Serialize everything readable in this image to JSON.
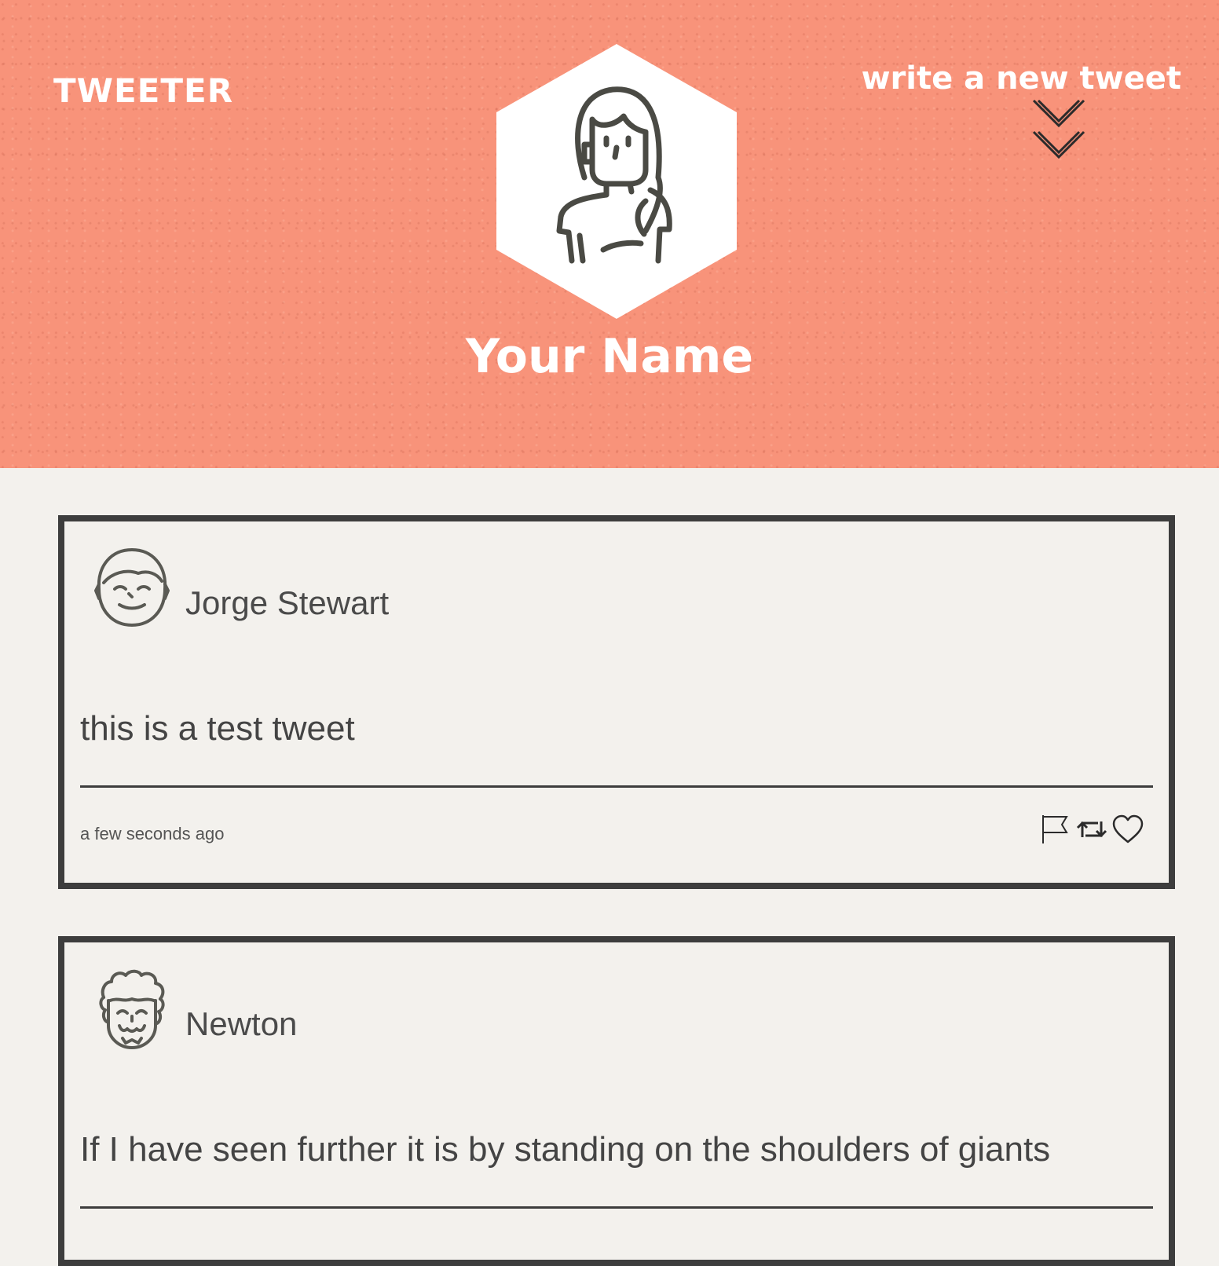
{
  "header": {
    "logo": "TWEETER",
    "compose_label": "write a new tweet",
    "compose_icon": "double-chevron-down-icon",
    "profile_name": "Your Name",
    "profile_avatar_icon": "woman-avatar-icon",
    "background_color": "#f8937a"
  },
  "tweets": [
    {
      "author": "Jorge Stewart",
      "avatar_icon": "smiling-man-avatar-icon",
      "text": "this is a test tweet",
      "time": "a few seconds ago",
      "actions": [
        "flag-icon",
        "retweet-icon",
        "heart-icon"
      ]
    },
    {
      "author": "Newton",
      "avatar_icon": "curly-hair-man-avatar-icon",
      "text": "If I have seen further it is by standing on the shoulders of giants",
      "time": "",
      "actions": []
    }
  ],
  "colors": {
    "page_background": "#f3f1ed",
    "border": "#3d3d3d",
    "text": "#444444"
  }
}
